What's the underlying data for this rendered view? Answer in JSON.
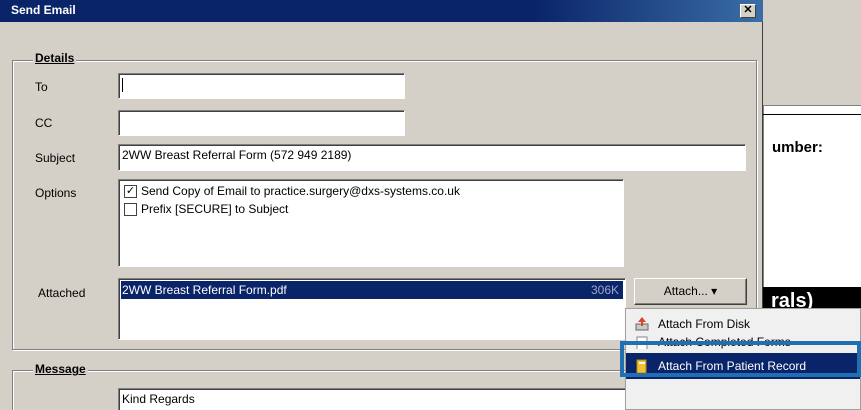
{
  "dialog": {
    "title": "Send Email",
    "close_glyph": "✕",
    "details": {
      "legend": "Details",
      "to_label": "To",
      "to_value": "",
      "cc_label": "CC",
      "cc_value": "",
      "subject_label": "Subject",
      "subject_value": "2WW Breast Referral Form  (572 949 2189)",
      "options_label": "Options",
      "options": [
        {
          "label": "Send Copy of Email to practice.surgery@dxs-systems.co.uk",
          "checked": true
        },
        {
          "label": "Prefix [SECURE] to Subject",
          "checked": false
        }
      ],
      "attached_label": "Attached",
      "attachments": [
        {
          "name": "2WW Breast Referral Form.pdf",
          "size": "306K"
        }
      ],
      "attach_button": "Attach...",
      "attach_arrow": "▾"
    },
    "message": {
      "legend": "Message",
      "body": "Kind Regards"
    }
  },
  "attach_menu": {
    "items": [
      {
        "label": "Attach From Disk",
        "icon": "disk-attach-icon"
      },
      {
        "label": "Attach Completed Forms",
        "icon": "forms-icon"
      },
      {
        "label": "Attach From Patient Record",
        "icon": "folder-icon"
      }
    ]
  },
  "background_window": {
    "number_label": "umber:",
    "banner_text": "rals)"
  },
  "colors": {
    "titlebar": "#0a246a",
    "selection": "#0a246a",
    "highlight": "#1f6fb2"
  }
}
